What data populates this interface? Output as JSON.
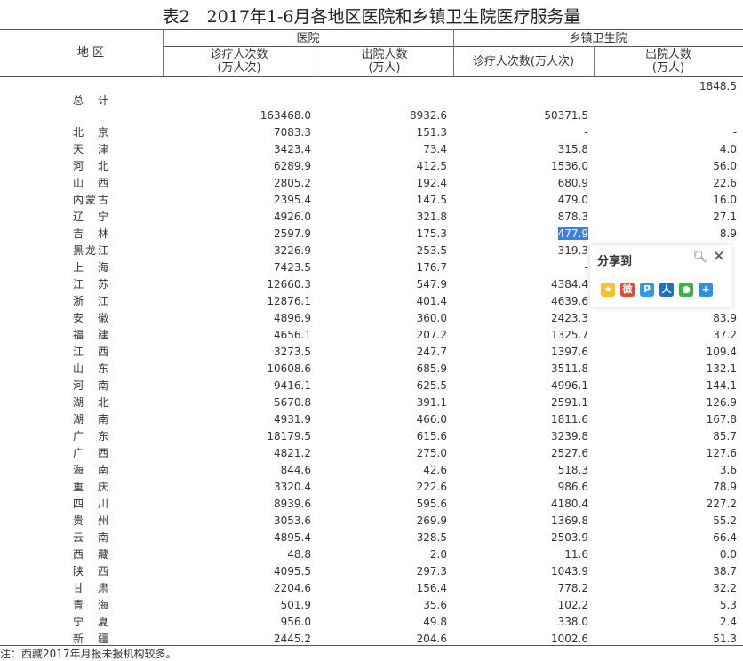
{
  "title": "表2　2017年1-6月各地区医院和乡镇卫生院医疗服务量",
  "header": {
    "region": "地 区",
    "hospital": "医院",
    "township": "乡镇卫生院",
    "visits": "诊疗人次数",
    "visits_unit": "(万人次)",
    "discharge": "出院人数",
    "discharge_unit": "(万人)",
    "visits_combined": "诊疗人次数(万人次)"
  },
  "total": {
    "label": "总 计",
    "extra": "1848.5",
    "c1": "163468.0",
    "c2": "8932.6",
    "c3": "50371.5"
  },
  "rows": [
    {
      "region": "北 京",
      "c1": "7083.3",
      "c2": "151.3",
      "c3": "-",
      "c4": "-"
    },
    {
      "region": "天 津",
      "c1": "3423.4",
      "c2": "73.4",
      "c3": "315.8",
      "c4": "4.0"
    },
    {
      "region": "河 北",
      "c1": "6289.9",
      "c2": "412.5",
      "c3": "1536.0",
      "c4": "56.0"
    },
    {
      "region": "山 西",
      "c1": "2805.2",
      "c2": "192.4",
      "c3": "680.9",
      "c4": "22.6"
    },
    {
      "region": "内蒙古",
      "c1": "2395.4",
      "c2": "147.5",
      "c3": "479.0",
      "c4": "16.0"
    },
    {
      "region": "辽 宁",
      "c1": "4926.0",
      "c2": "321.8",
      "c3": "878.3",
      "c4": "27.1"
    },
    {
      "region": "吉 林",
      "c1": "2597.9",
      "c2": "175.3",
      "c3": "477.9",
      "c4": "8.9"
    },
    {
      "region": "黑龙江",
      "c1": "3226.9",
      "c2": "253.5",
      "c3": "319.3",
      "c4": ""
    },
    {
      "region": "上 海",
      "c1": "7423.5",
      "c2": "176.7",
      "c3": "-",
      "c4": ""
    },
    {
      "region": "江 苏",
      "c1": "12660.3",
      "c2": "547.9",
      "c3": "4384.4",
      "c4": ""
    },
    {
      "region": "浙 江",
      "c1": "12876.1",
      "c2": "401.4",
      "c3": "4639.6",
      "c4": ""
    },
    {
      "region": "安 徽",
      "c1": "4896.9",
      "c2": "360.0",
      "c3": "2423.3",
      "c4": "83.9"
    },
    {
      "region": "福 建",
      "c1": "4656.1",
      "c2": "207.2",
      "c3": "1325.7",
      "c4": "37.2"
    },
    {
      "region": "江 西",
      "c1": "3273.5",
      "c2": "247.7",
      "c3": "1397.6",
      "c4": "109.4"
    },
    {
      "region": "山 东",
      "c1": "10608.6",
      "c2": "685.9",
      "c3": "3511.8",
      "c4": "132.1"
    },
    {
      "region": "河 南",
      "c1": "9416.1",
      "c2": "625.5",
      "c3": "4996.1",
      "c4": "144.1"
    },
    {
      "region": "湖 北",
      "c1": "5670.8",
      "c2": "391.1",
      "c3": "2591.1",
      "c4": "126.9"
    },
    {
      "region": "湖 南",
      "c1": "4931.9",
      "c2": "466.0",
      "c3": "1811.6",
      "c4": "167.8"
    },
    {
      "region": "广 东",
      "c1": "18179.5",
      "c2": "615.6",
      "c3": "3239.8",
      "c4": "85.7"
    },
    {
      "region": "广 西",
      "c1": "4821.2",
      "c2": "275.0",
      "c3": "2527.6",
      "c4": "127.6"
    },
    {
      "region": "海 南",
      "c1": "844.6",
      "c2": "42.6",
      "c3": "518.3",
      "c4": "3.6"
    },
    {
      "region": "重 庆",
      "c1": "3320.4",
      "c2": "222.6",
      "c3": "986.6",
      "c4": "78.9"
    },
    {
      "region": "四 川",
      "c1": "8939.6",
      "c2": "595.6",
      "c3": "4180.4",
      "c4": "227.2"
    },
    {
      "region": "贵 州",
      "c1": "3053.6",
      "c2": "269.9",
      "c3": "1369.8",
      "c4": "55.2"
    },
    {
      "region": "云 南",
      "c1": "4895.4",
      "c2": "328.5",
      "c3": "2503.9",
      "c4": "66.4"
    },
    {
      "region": "西 藏",
      "c1": "48.8",
      "c2": "2.0",
      "c3": "11.6",
      "c4": "0.0"
    },
    {
      "region": "陕 西",
      "c1": "4095.5",
      "c2": "297.3",
      "c3": "1043.9",
      "c4": "38.7"
    },
    {
      "region": "甘 肃",
      "c1": "2204.6",
      "c2": "156.4",
      "c3": "778.2",
      "c4": "32.2"
    },
    {
      "region": "青 海",
      "c1": "501.9",
      "c2": "35.6",
      "c3": "102.2",
      "c4": "5.3"
    },
    {
      "region": "宁 夏",
      "c1": "956.0",
      "c2": "49.8",
      "c3": "338.0",
      "c4": "2.4"
    },
    {
      "region": "新 疆",
      "c1": "2445.2",
      "c2": "204.6",
      "c3": "1002.6",
      "c4": "51.3"
    }
  ],
  "share": {
    "label": "分享到",
    "icons": [
      "qzone-icon",
      "weibo-icon",
      "tencent-weibo-icon",
      "renren-icon",
      "wechat-icon",
      "more-icon"
    ]
  },
  "note": "注：西藏2017年月报未报机构较多。"
}
